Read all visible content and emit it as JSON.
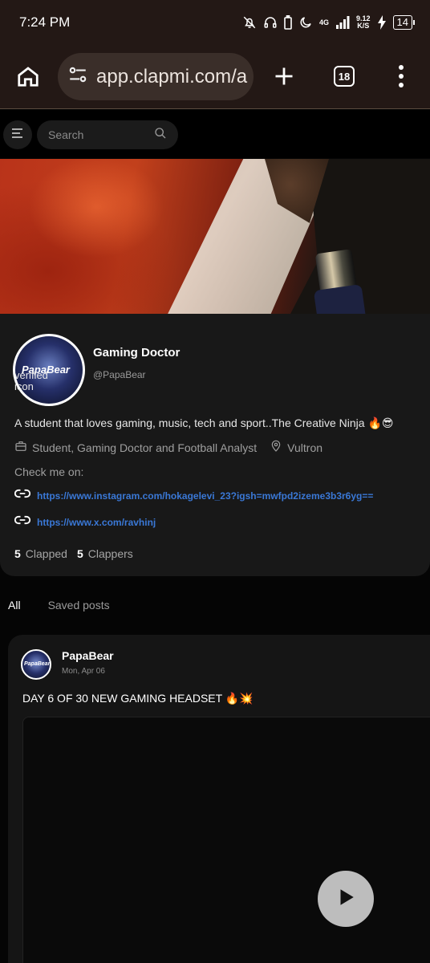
{
  "status": {
    "time": "7:24 PM",
    "network": "4G",
    "speed_top": "9.12",
    "speed_bottom": "K/S",
    "battery": "14"
  },
  "browser": {
    "url": "app.clapmi.com/a",
    "tab_count": "18"
  },
  "header": {
    "search_placeholder": "Search"
  },
  "profile": {
    "display_name": "Gaming Doctor",
    "handle": "@PapaBear",
    "avatar_text": "PapaBear",
    "verified_alt": "verified icon",
    "bio": "A student that loves gaming, music, tech and sport..The Creative Ninja 🔥😎",
    "occupation": "Student, Gaming Doctor and Football Analyst",
    "location": "Vultron",
    "check_label": "Check me on:",
    "links": [
      "https://www.instagram.com/hokagelevi_23?igsh=mwfpd2izeme3b3r6yg==",
      "https://www.x.com/ravhinj"
    ],
    "clapped_count": "5",
    "clapped_label": "Clapped",
    "clappers_count": "5",
    "clappers_label": "Clappers"
  },
  "tabs": {
    "all": "All",
    "saved": "Saved posts"
  },
  "post": {
    "author": "PapaBear",
    "avatar_text": "PapaBear",
    "date": "Mon, Apr 06",
    "text": "DAY 6 OF 30 NEW GAMING HEADSET 🔥💥"
  }
}
